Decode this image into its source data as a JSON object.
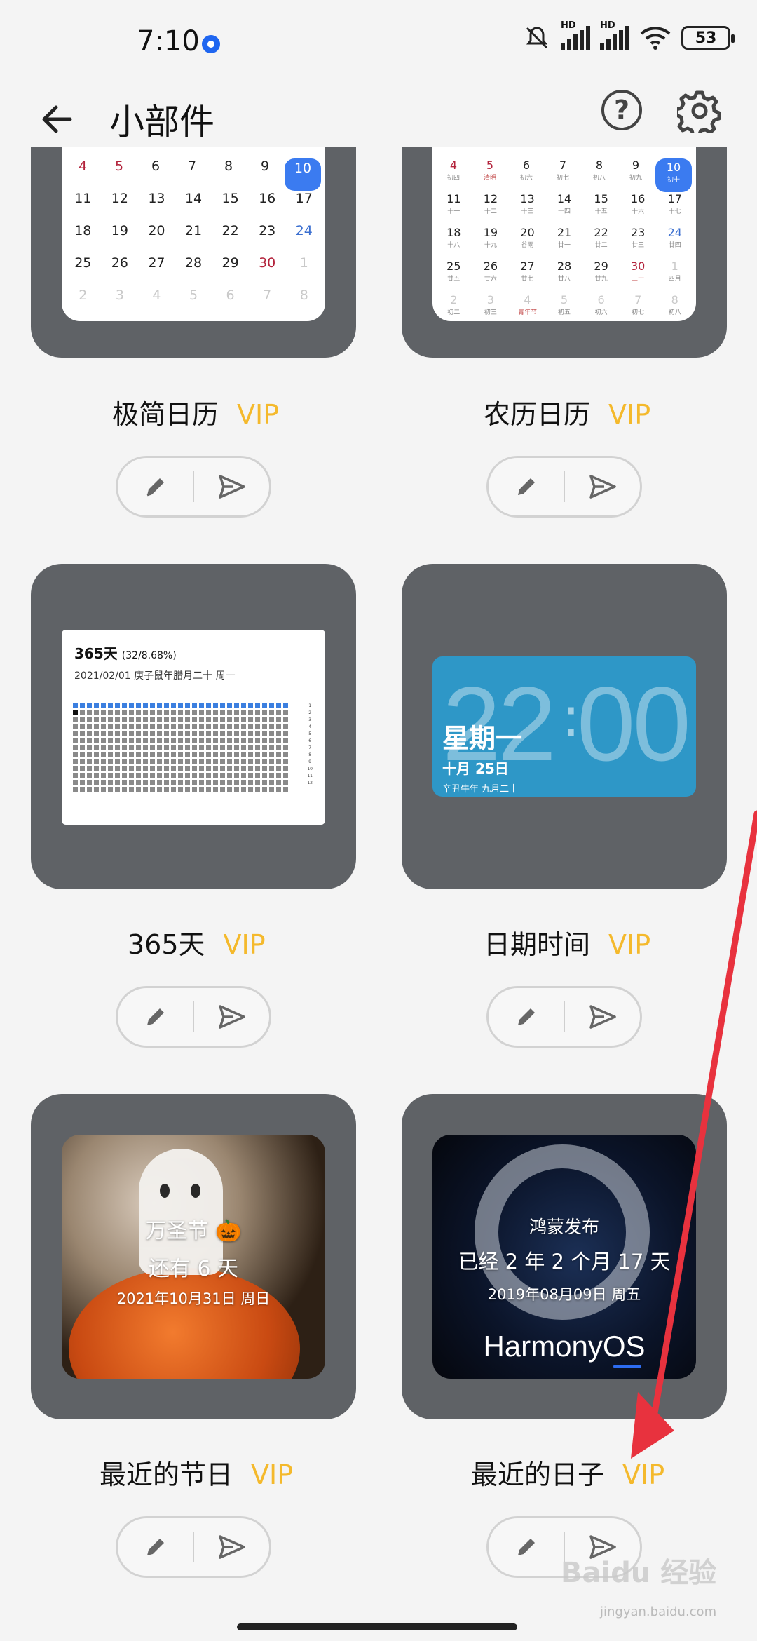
{
  "status_bar": {
    "time": "7:10",
    "battery": "53",
    "hd_label": "HD"
  },
  "header": {
    "title": "小部件",
    "help_glyph": "?"
  },
  "calendar_days": {
    "simple": [
      [
        "4",
        "5",
        "6",
        "7",
        "8",
        "9",
        "10"
      ],
      [
        "11",
        "12",
        "13",
        "14",
        "15",
        "16",
        "17"
      ],
      [
        "18",
        "19",
        "20",
        "21",
        "22",
        "23",
        "24"
      ],
      [
        "25",
        "26",
        "27",
        "28",
        "29",
        "30",
        "1"
      ],
      [
        "2",
        "3",
        "4",
        "5",
        "6",
        "7",
        "8"
      ]
    ],
    "lunar": [
      [
        "4",
        "5",
        "6",
        "7",
        "8",
        "9",
        "10"
      ],
      [
        "11",
        "12",
        "13",
        "14",
        "15",
        "16",
        "17"
      ],
      [
        "18",
        "19",
        "20",
        "21",
        "22",
        "23",
        "24"
      ],
      [
        "25",
        "26",
        "27",
        "28",
        "29",
        "30",
        "1"
      ],
      [
        "2",
        "3",
        "4",
        "5",
        "6",
        "7",
        "8"
      ]
    ],
    "lunar_sub": [
      [
        "初四",
        "清明",
        "初六",
        "初七",
        "初八",
        "初九",
        "初十"
      ],
      [
        "十一",
        "十二",
        "十三",
        "十四",
        "十五",
        "十六",
        "十七"
      ],
      [
        "十八",
        "十九",
        "谷雨",
        "廿一",
        "廿二",
        "廿三",
        "廿四"
      ],
      [
        "廿五",
        "廿六",
        "廿七",
        "廿八",
        "廿九",
        "三十",
        "四月"
      ],
      [
        "初二",
        "初三",
        "青年节",
        "初五",
        "初六",
        "初七",
        "初八"
      ]
    ]
  },
  "widgets": {
    "w1": {
      "name": "极简日历",
      "vip": "VIP"
    },
    "w2": {
      "name": "农历日历",
      "vip": "VIP"
    },
    "w3": {
      "name": "365天",
      "vip": "VIP",
      "heading": "365天",
      "heading_small": "(32/8.68%)",
      "date_line": "2021/02/01 庚子鼠年腊月二十 周一"
    },
    "w4": {
      "name": "日期时间",
      "vip": "VIP",
      "time": "22",
      "time_min": "00",
      "weekday": "星期一",
      "date": "十月 25日",
      "lunar": "辛丑牛年 九月二十"
    },
    "w5": {
      "name": "最近的节日",
      "vip": "VIP",
      "event": "万圣节 🎃",
      "countdown": "还有 6 天",
      "date": "2021年10月31日 周日"
    },
    "w6": {
      "name": "最近的日子",
      "vip": "VIP",
      "event": "鸿蒙发布",
      "elapsed": "已经 2 年 2 个月 17 天",
      "date": "2019年08月09日 周五",
      "logo": "HarmonyOS"
    }
  },
  "months_axis": [
    "1",
    "2",
    "3",
    "4",
    "5",
    "6",
    "7",
    "8",
    "9",
    "10",
    "11",
    "12"
  ],
  "watermark": {
    "main": "Baidu 经验",
    "sub": "jingyan.baidu.com"
  },
  "colors": {
    "card_bg": "#5f6266",
    "vip": "#f4b92c",
    "accent_blue": "#3b7bf0",
    "arrow": "#e8323e"
  },
  "icons": {
    "edit": "pencil-icon",
    "send": "send-icon",
    "back": "arrow-left-icon",
    "settings": "gear-icon",
    "help": "help-icon"
  }
}
